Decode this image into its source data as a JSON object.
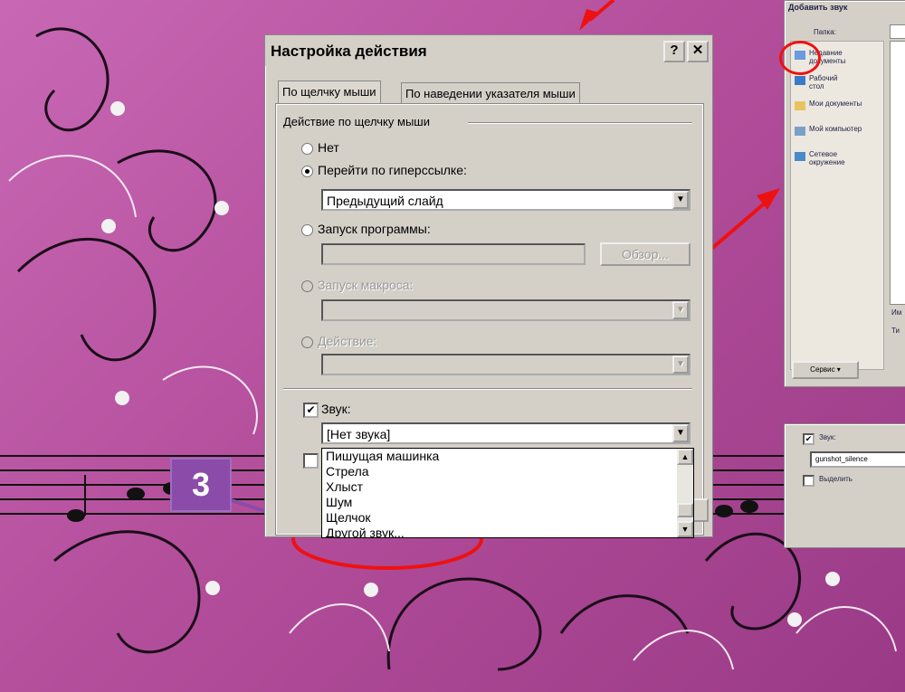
{
  "dialog": {
    "title": "Настройка действия",
    "help_label": "?",
    "close_label": "✕",
    "tabs": [
      "По щелчку мыши",
      "По наведении указателя мыши"
    ],
    "group_label": "Действие по щелчку мыши",
    "options": {
      "none": "Нет",
      "hyperlink": "Перейти по гиперссылке:",
      "program": "Запуск программы:",
      "macro": "Запуск макроса:",
      "action": "Действие:"
    },
    "hyperlink_value": "Предыдущий слайд",
    "browse_label": "Обзор...",
    "sound_label": "Звук:",
    "sound_value": "[Нет звука]",
    "sound_list": [
      "Пишущая машинка",
      "Стрела",
      "Хлыст",
      "Шум",
      "Щелчок",
      "Другой звук..."
    ]
  },
  "callout_number": "3",
  "add_sound_dialog": {
    "title": "Добавить звук",
    "folder_label": "Папка:",
    "places": [
      "Недавние документы",
      "Рабочий стол",
      "Мои документы",
      "Мой компьютер",
      "Сетевое окружение"
    ],
    "service_button": "Сервис",
    "clipped_labels": [
      "Им",
      "Ти"
    ]
  },
  "sound_panel_snippet": {
    "sound_label": "Звук:",
    "sound_value": "gunshot_silence",
    "highlight_label": "Выделить"
  },
  "colors": {
    "dialog_bg": "#d4d0c8",
    "arrow": "#ee1111",
    "background": "#b44f9c"
  }
}
